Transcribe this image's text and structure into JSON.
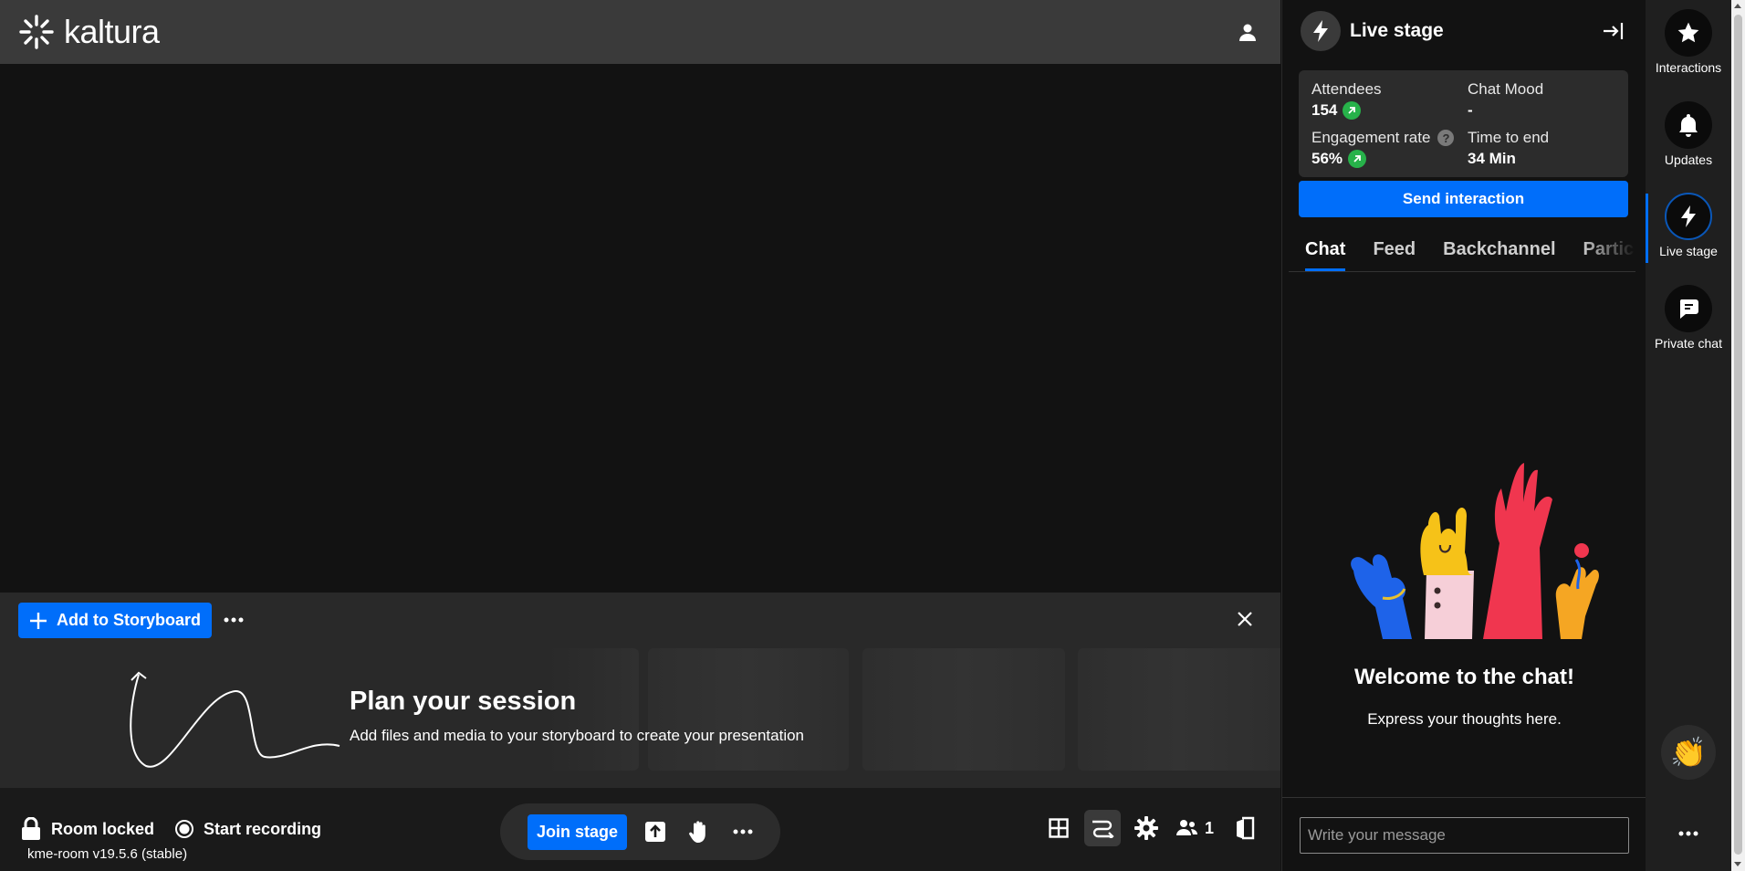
{
  "header": {
    "logo_text": "kaltura"
  },
  "storyboard": {
    "add_label": "Add to Storyboard",
    "title": "Plan your session",
    "subtitle": "Add files and media to your storyboard to create your presentation"
  },
  "bottom_bar": {
    "room_locked": "Room locked",
    "start_recording": "Start recording",
    "version": "kme-room v19.5.6 (stable)",
    "join_stage": "Join stage",
    "participants_count": "1"
  },
  "live_stage": {
    "title": "Live stage",
    "stats": {
      "attendees_label": "Attendees",
      "attendees_value": "154",
      "chat_mood_label": "Chat Mood",
      "chat_mood_value": "-",
      "engagement_label": "Engagement rate",
      "engagement_value": "56%",
      "time_label": "Time to end",
      "time_value": "34 Min"
    },
    "send_interaction": "Send interaction",
    "tabs": [
      "Chat",
      "Feed",
      "Backchannel",
      "Participants"
    ],
    "active_tab": "Chat",
    "welcome": "Welcome to the chat!",
    "express": "Express your thoughts here.",
    "input_placeholder": "Write your message"
  },
  "rail": {
    "interactions": "Interactions",
    "updates": "Updates",
    "live_stage": "Live stage",
    "private_chat": "Private chat"
  },
  "colors": {
    "accent": "#006efa",
    "up_trend": "#27b24a"
  }
}
